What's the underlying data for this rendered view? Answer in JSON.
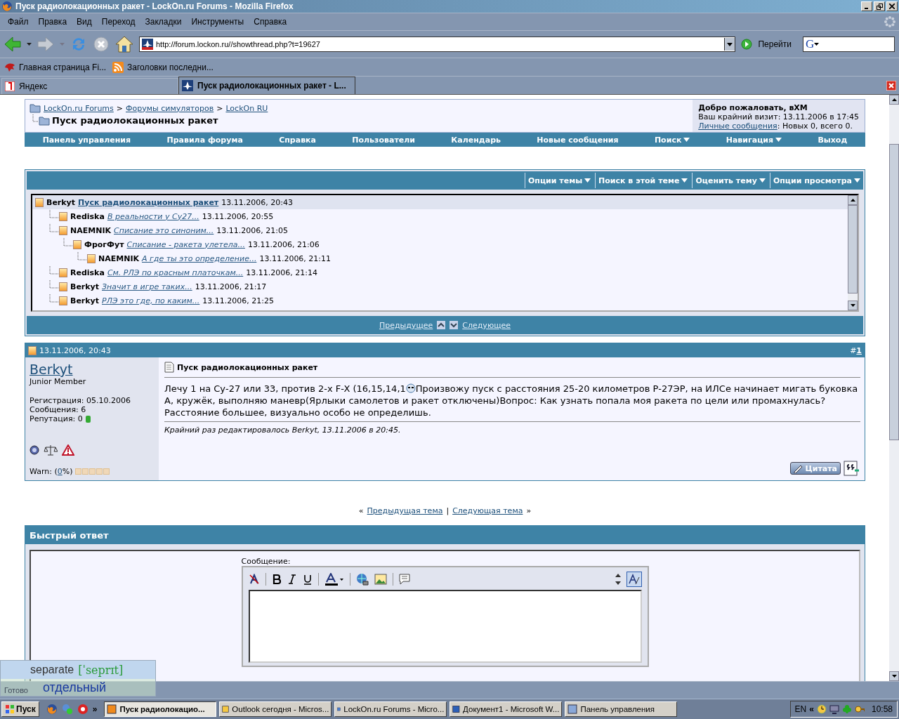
{
  "window": {
    "title": "Пуск радиолокационных ракет - LockOn.ru Forums - Mozilla Firefox"
  },
  "menu": [
    "Файл",
    "Правка",
    "Вид",
    "Переход",
    "Закладки",
    "Инструменты",
    "Справка"
  ],
  "toolbar": {
    "url": "http://forum.lockon.ru//showthread.php?t=19627",
    "go_label": "Перейти",
    "search_engine": "G"
  },
  "bookmarks": [
    "Главная страница Fi...",
    "Заголовки последни..."
  ],
  "tabs": [
    {
      "label": "Яндекс",
      "selected": false
    },
    {
      "label": "Пуск радиолокационных ракет - L...",
      "selected": true
    }
  ],
  "forum": {
    "breadcrumbs": [
      "LockOn.ru Forums",
      "Форумы симуляторов",
      "LockOn RU"
    ],
    "breadcrumb_separator": ">",
    "thread_title": "Пуск радиолокационных ракет",
    "welcome": {
      "greeting": "Добро пожаловать, вXM",
      "last_visit": "Ваш крайний визит: 13.11.2006 в 17:45",
      "pm_link": "Личные сообщения",
      "pm_rest": ": Новых 0, всего 0."
    }
  },
  "navbar": [
    {
      "label": "Панель управления",
      "dropdown": false
    },
    {
      "label": "Правила форума",
      "dropdown": false
    },
    {
      "label": "Справка",
      "dropdown": false
    },
    {
      "label": "Пользователи",
      "dropdown": false
    },
    {
      "label": "Календарь",
      "dropdown": false
    },
    {
      "label": "Новые сообщения",
      "dropdown": false
    },
    {
      "label": "Поиск",
      "dropdown": true
    },
    {
      "label": "Навигация",
      "dropdown": true
    },
    {
      "label": "Выход",
      "dropdown": false
    }
  ],
  "thread_tools": [
    "Опции темы",
    "Поиск в этой теме",
    "Оценить тему",
    "Опции просмотра"
  ],
  "thread_tree": [
    {
      "author": "Berkyt",
      "title": "Пуск радиолокационных ракет",
      "time": "13.11.2006, 20:43",
      "selected": true,
      "children": [
        {
          "author": "Rediska",
          "title": "В реальности у Су27...",
          "time": "13.11.2006, 20:55",
          "selected": false
        },
        {
          "author": "NAEMNIK",
          "title": "Списание это синоним...",
          "time": "13.11.2006, 21:05",
          "selected": false,
          "children": [
            {
              "author": "ФрогФут",
              "title": "Списание - ракета улетела...",
              "time": "13.11.2006, 21:06",
              "selected": false,
              "children": [
                {
                  "author": "NAEMNIK",
                  "title": "А где ты это определение...",
                  "time": "13.11.2006, 21:11",
                  "selected": false
                }
              ]
            }
          ]
        },
        {
          "author": "Rediska",
          "title": "См. РЛЭ по красным платочкам...",
          "time": "13.11.2006, 21:14",
          "selected": false
        },
        {
          "author": "Berkyt",
          "title": "Значит в игре таких...",
          "time": "13.11.2006, 21:17",
          "selected": false
        },
        {
          "author": "Berkyt",
          "title": "РЛЭ это где, по каким...",
          "time": "13.11.2006, 21:25",
          "selected": false
        }
      ]
    }
  ],
  "tree_nav": {
    "prev": "Предыдущее",
    "next": "Следующее"
  },
  "post": {
    "date": "13.11.2006, 20:43",
    "number_prefix": "#",
    "number": "1",
    "username": "Berkyt",
    "user_title": "Junior Member",
    "stats": [
      "Регистрация: 05.10.2006",
      "Сообщения: 6",
      "Репутация: 0"
    ],
    "warn_prefix": "Warn: (",
    "warn_value": "0",
    "warn_suffix": "%)",
    "title": "Пуск радиолокационных ракет",
    "body_before": "Лечу 1 на Су-27 или 33, против 2-х F-X (16,15,14,1",
    "body_after": "Произвожу пуск с расстояния 25-20 километров Р-27ЭР, на ИЛСе начинает мигать буковка А, кружёк, выполняю маневр(Ярлыки самолетов и ракет отключены)Вопрос: Как узнать попала моя ракета по цели или промахнулась?Расстояние большее, визуально особо не определишь.",
    "edited": "Крайний раз редактировалось Berkyt, 13.11.2006 в 20:45.",
    "quote_button": "Цитата"
  },
  "thread_nav": {
    "left": "«",
    "prev": "Предыдущая тема",
    "sep": "|",
    "next": "Следующая тема",
    "right": "»"
  },
  "quick_reply": {
    "title": "Быстрый ответ",
    "label": "Сообщение:"
  },
  "status_bar": "Готово",
  "translation_popup": {
    "word": "separate",
    "transcription": "[ˈseprɪt]",
    "translation": "отдельный"
  },
  "taskbar": {
    "start": "Пуск",
    "more": "»",
    "items": [
      {
        "label": "Пуск радиолокацио...",
        "selected": true
      },
      {
        "label": "Outlook сегодня - Micros...",
        "selected": false
      },
      {
        "label": "LockOn.ru Forums - Micro...",
        "selected": false
      },
      {
        "label": "Документ1 - Microsoft W...",
        "selected": false
      },
      {
        "label": "Панель управления",
        "selected": false
      }
    ],
    "tray_expand": "«",
    "lang": "EN",
    "clock": "10:58"
  }
}
